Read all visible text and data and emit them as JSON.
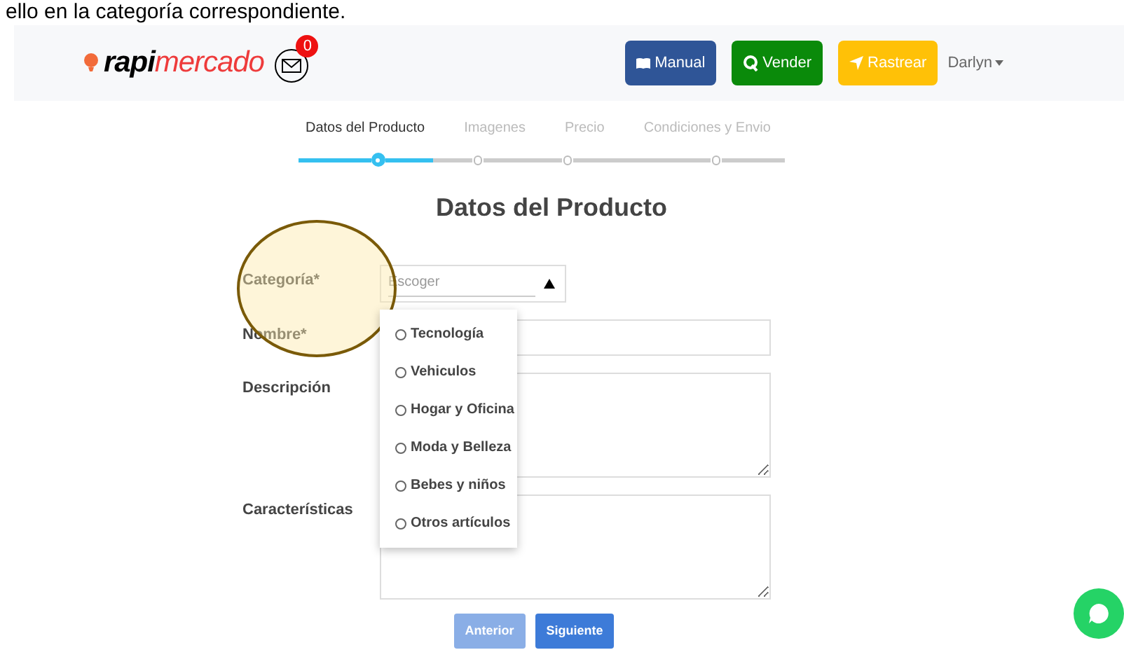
{
  "caption": "ello en la categoría correspondiente.",
  "header": {
    "logo": {
      "first": "rapi",
      "second": "mercado"
    },
    "mail_count": "0",
    "buttons": [
      {
        "label": "Manual",
        "kind": "manual"
      },
      {
        "label": "Vender",
        "kind": "sell"
      },
      {
        "label": "Rastrear",
        "kind": "track"
      }
    ],
    "user": "Darlyn"
  },
  "steps": [
    {
      "label": "Datos del Producto",
      "selected": true
    },
    {
      "label": "Imagenes",
      "selected": false
    },
    {
      "label": "Precio",
      "selected": false
    },
    {
      "label": "Condiciones y Envio",
      "selected": false
    }
  ],
  "title": "Datos del Producto",
  "fields": [
    {
      "label": "Categoría*",
      "kind": "select",
      "placeholder": "Escoger",
      "expanded": true
    },
    {
      "label": "Nombre*",
      "kind": "input"
    },
    {
      "label": "Descripción",
      "kind": "textarea"
    },
    {
      "label": "Características",
      "kind": "textarea"
    }
  ],
  "options": [
    {
      "label": "Tecnología",
      "selected": false
    },
    {
      "label": "Vehiculos",
      "selected": false
    },
    {
      "label": "Hogar y Oficina",
      "selected": false
    },
    {
      "label": "Moda y Belleza",
      "selected": false
    },
    {
      "label": "Bebes y niños",
      "selected": false
    },
    {
      "label": "Otros artículos",
      "selected": false
    }
  ],
  "nav_buttons": [
    {
      "label": "Anterior",
      "disabled": true
    },
    {
      "label": "Siguiente",
      "disabled": false
    }
  ]
}
